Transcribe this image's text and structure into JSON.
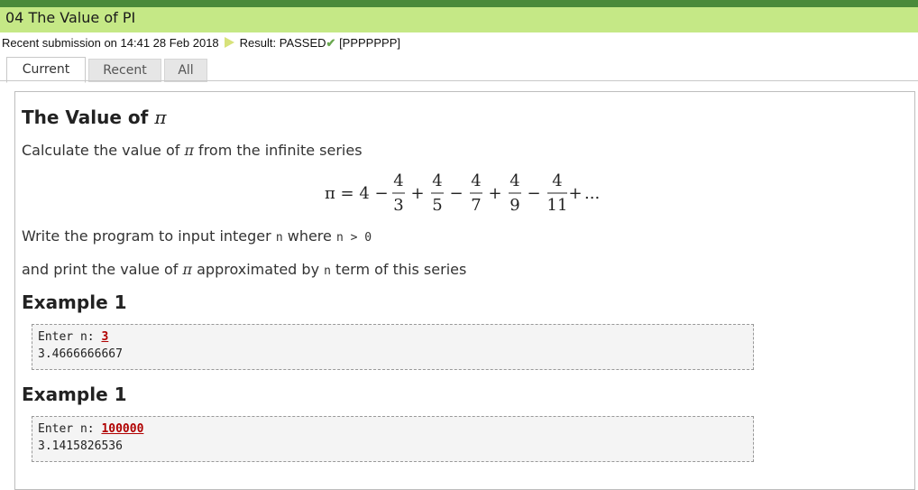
{
  "window": {
    "title": "04 The Value of PI"
  },
  "submission": {
    "text": "Recent submission on 14:41 28 Feb 2018",
    "result_label": "Result: PASSED",
    "result_code": "[PPPPPPP]"
  },
  "tabs": [
    {
      "label": "Current"
    },
    {
      "label": "Recent"
    },
    {
      "label": "All"
    }
  ],
  "problem": {
    "heading_text": "The Value of ",
    "pi_symbol": "π",
    "line1_before": "Calculate the value of ",
    "line1_after": " from the infinite series",
    "line2_before": "Write the program to input integer ",
    "line2_var": "n",
    "line2_mid": " where ",
    "line2_cond": "n > 0",
    "line3_before": "and print the value of ",
    "line3_mid": " approximated by ",
    "line3_var": "n",
    "line3_after": " term of this series"
  },
  "formula": {
    "lhs": "π = 4 −",
    "numerator": "4",
    "denominators": [
      "3",
      "5",
      "7",
      "9",
      "11"
    ],
    "operators": [
      "+",
      "−",
      "+",
      "−",
      "+"
    ],
    "tail": "..."
  },
  "examples": [
    {
      "heading": "Example 1",
      "prompt": "Enter n: ",
      "input": "3",
      "output": "3.4666666667"
    },
    {
      "heading": "Example 1",
      "prompt": "Enter n: ",
      "input": "100000",
      "output": "3.1415826536"
    }
  ]
}
